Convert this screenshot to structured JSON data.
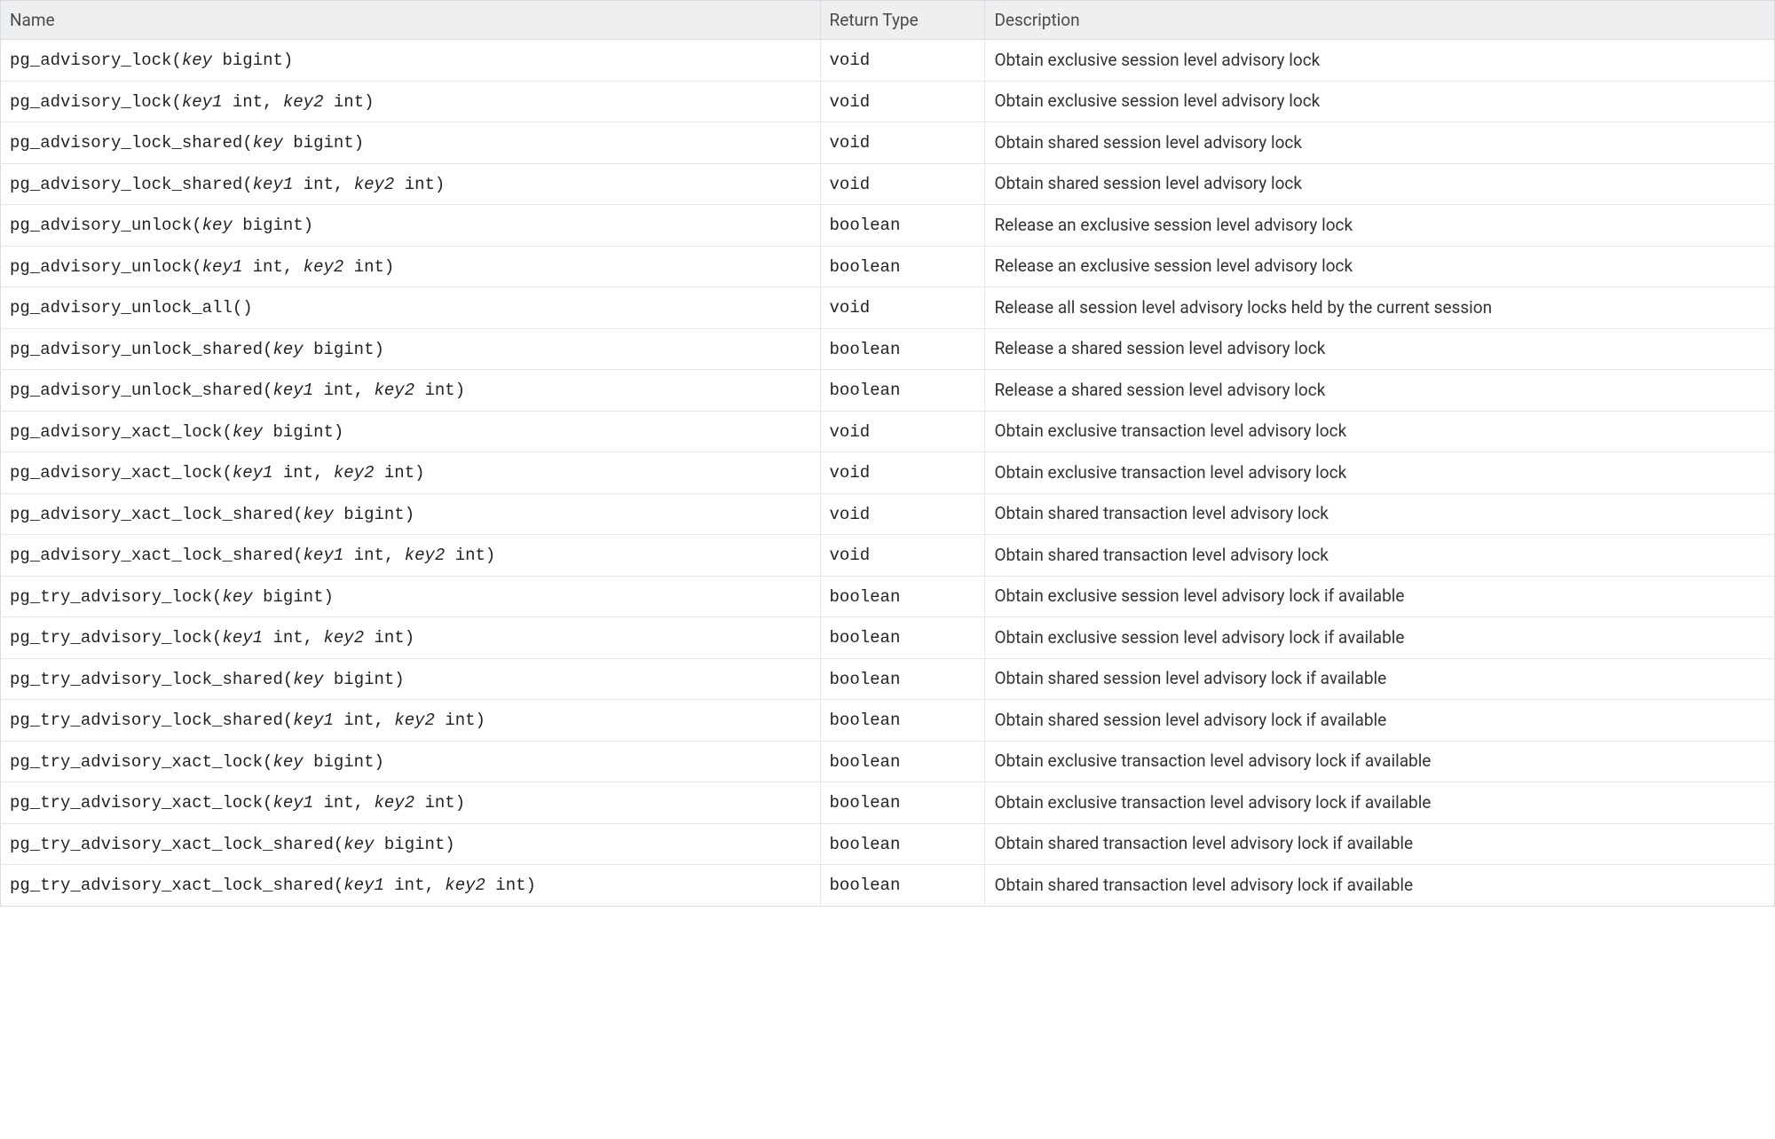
{
  "headers": {
    "name": "Name",
    "return_type": "Return Type",
    "description": "Description"
  },
  "rows": [
    {
      "signature": [
        {
          "t": "fn",
          "v": "pg_advisory_lock("
        },
        {
          "t": "rep",
          "v": "key"
        },
        {
          "t": "fn",
          "v": " bigint)"
        }
      ],
      "return_type": "void",
      "description": "Obtain exclusive session level advisory lock"
    },
    {
      "signature": [
        {
          "t": "fn",
          "v": "pg_advisory_lock("
        },
        {
          "t": "rep",
          "v": "key1"
        },
        {
          "t": "fn",
          "v": " int, "
        },
        {
          "t": "rep",
          "v": "key2"
        },
        {
          "t": "fn",
          "v": " int)"
        }
      ],
      "return_type": "void",
      "description": "Obtain exclusive session level advisory lock"
    },
    {
      "signature": [
        {
          "t": "fn",
          "v": "pg_advisory_lock_shared("
        },
        {
          "t": "rep",
          "v": "key"
        },
        {
          "t": "fn",
          "v": " bigint)"
        }
      ],
      "return_type": "void",
      "description": "Obtain shared session level advisory lock"
    },
    {
      "signature": [
        {
          "t": "fn",
          "v": "pg_advisory_lock_shared("
        },
        {
          "t": "rep",
          "v": "key1"
        },
        {
          "t": "fn",
          "v": " int, "
        },
        {
          "t": "rep",
          "v": "key2"
        },
        {
          "t": "fn",
          "v": " int)"
        }
      ],
      "return_type": "void",
      "description": "Obtain shared session level advisory lock"
    },
    {
      "signature": [
        {
          "t": "fn",
          "v": "pg_advisory_unlock("
        },
        {
          "t": "rep",
          "v": "key"
        },
        {
          "t": "fn",
          "v": " bigint)"
        }
      ],
      "return_type": "boolean",
      "description": "Release an exclusive session level advisory lock"
    },
    {
      "signature": [
        {
          "t": "fn",
          "v": "pg_advisory_unlock("
        },
        {
          "t": "rep",
          "v": "key1"
        },
        {
          "t": "fn",
          "v": " int, "
        },
        {
          "t": "rep",
          "v": "key2"
        },
        {
          "t": "fn",
          "v": " int)"
        }
      ],
      "return_type": "boolean",
      "description": "Release an exclusive session level advisory lock"
    },
    {
      "signature": [
        {
          "t": "fn",
          "v": "pg_advisory_unlock_all()"
        }
      ],
      "return_type": "void",
      "description": "Release all session level advisory locks held by the current session"
    },
    {
      "signature": [
        {
          "t": "fn",
          "v": "pg_advisory_unlock_shared("
        },
        {
          "t": "rep",
          "v": "key"
        },
        {
          "t": "fn",
          "v": " bigint)"
        }
      ],
      "return_type": "boolean",
      "description": "Release a shared session level advisory lock"
    },
    {
      "signature": [
        {
          "t": "fn",
          "v": "pg_advisory_unlock_shared("
        },
        {
          "t": "rep",
          "v": "key1"
        },
        {
          "t": "fn",
          "v": " int, "
        },
        {
          "t": "rep",
          "v": "key2"
        },
        {
          "t": "fn",
          "v": " int)"
        }
      ],
      "return_type": "boolean",
      "description": "Release a shared session level advisory lock"
    },
    {
      "signature": [
        {
          "t": "fn",
          "v": "pg_advisory_xact_lock("
        },
        {
          "t": "rep",
          "v": "key"
        },
        {
          "t": "fn",
          "v": " bigint)"
        }
      ],
      "return_type": "void",
      "description": "Obtain exclusive transaction level advisory lock"
    },
    {
      "signature": [
        {
          "t": "fn",
          "v": "pg_advisory_xact_lock("
        },
        {
          "t": "rep",
          "v": "key1"
        },
        {
          "t": "fn",
          "v": " int, "
        },
        {
          "t": "rep",
          "v": "key2"
        },
        {
          "t": "fn",
          "v": " int)"
        }
      ],
      "return_type": "void",
      "description": "Obtain exclusive transaction level advisory lock"
    },
    {
      "signature": [
        {
          "t": "fn",
          "v": "pg_advisory_xact_lock_shared("
        },
        {
          "t": "rep",
          "v": "key"
        },
        {
          "t": "fn",
          "v": " bigint)"
        }
      ],
      "return_type": "void",
      "description": "Obtain shared transaction level advisory lock"
    },
    {
      "signature": [
        {
          "t": "fn",
          "v": "pg_advisory_xact_lock_shared("
        },
        {
          "t": "rep",
          "v": "key1"
        },
        {
          "t": "fn",
          "v": " int, "
        },
        {
          "t": "rep",
          "v": "key2"
        },
        {
          "t": "fn",
          "v": " int)"
        }
      ],
      "return_type": "void",
      "description": "Obtain shared transaction level advisory lock"
    },
    {
      "signature": [
        {
          "t": "fn",
          "v": "pg_try_advisory_lock("
        },
        {
          "t": "rep",
          "v": "key"
        },
        {
          "t": "fn",
          "v": " bigint)"
        }
      ],
      "return_type": "boolean",
      "description": "Obtain exclusive session level advisory lock if available"
    },
    {
      "signature": [
        {
          "t": "fn",
          "v": "pg_try_advisory_lock("
        },
        {
          "t": "rep",
          "v": "key1"
        },
        {
          "t": "fn",
          "v": " int, "
        },
        {
          "t": "rep",
          "v": "key2"
        },
        {
          "t": "fn",
          "v": " int)"
        }
      ],
      "return_type": "boolean",
      "description": "Obtain exclusive session level advisory lock if available"
    },
    {
      "signature": [
        {
          "t": "fn",
          "v": "pg_try_advisory_lock_shared("
        },
        {
          "t": "rep",
          "v": "key"
        },
        {
          "t": "fn",
          "v": " bigint)"
        }
      ],
      "return_type": "boolean",
      "description": "Obtain shared session level advisory lock if available"
    },
    {
      "signature": [
        {
          "t": "fn",
          "v": "pg_try_advisory_lock_shared("
        },
        {
          "t": "rep",
          "v": "key1"
        },
        {
          "t": "fn",
          "v": " int, "
        },
        {
          "t": "rep",
          "v": "key2"
        },
        {
          "t": "fn",
          "v": " int)"
        }
      ],
      "return_type": "boolean",
      "description": "Obtain shared session level advisory lock if available"
    },
    {
      "signature": [
        {
          "t": "fn",
          "v": "pg_try_advisory_xact_lock("
        },
        {
          "t": "rep",
          "v": "key"
        },
        {
          "t": "fn",
          "v": " bigint)"
        }
      ],
      "return_type": "boolean",
      "description": "Obtain exclusive transaction level advisory lock if available"
    },
    {
      "signature": [
        {
          "t": "fn",
          "v": "pg_try_advisory_xact_lock("
        },
        {
          "t": "rep",
          "v": "key1"
        },
        {
          "t": "fn",
          "v": " int, "
        },
        {
          "t": "rep",
          "v": "key2"
        },
        {
          "t": "fn",
          "v": " int)"
        }
      ],
      "return_type": "boolean",
      "description": "Obtain exclusive transaction level advisory lock if available"
    },
    {
      "signature": [
        {
          "t": "fn",
          "v": "pg_try_advisory_xact_lock_shared("
        },
        {
          "t": "rep",
          "v": "key"
        },
        {
          "t": "fn",
          "v": " bigint)"
        }
      ],
      "return_type": "boolean",
      "description": "Obtain shared transaction level advisory lock if available"
    },
    {
      "signature": [
        {
          "t": "fn",
          "v": "pg_try_advisory_xact_lock_shared("
        },
        {
          "t": "rep",
          "v": "key1"
        },
        {
          "t": "fn",
          "v": " int, "
        },
        {
          "t": "rep",
          "v": "key2"
        },
        {
          "t": "fn",
          "v": " int)"
        }
      ],
      "return_type": "boolean",
      "description": "Obtain shared transaction level advisory lock if available"
    }
  ]
}
